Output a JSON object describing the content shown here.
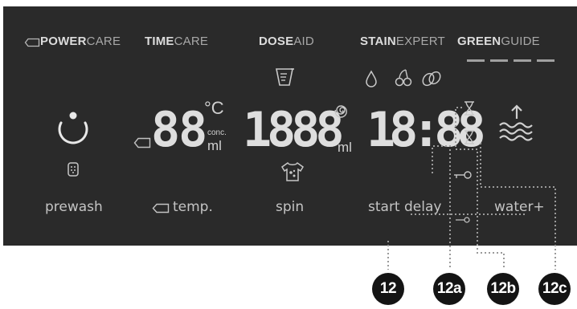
{
  "programs": {
    "powercare": {
      "bold": "POWER",
      "light": "CARE"
    },
    "timecare": {
      "bold": "TIME",
      "light": "CARE"
    },
    "doseaid": {
      "bold": "DOSE",
      "light": "AID"
    },
    "stainexpert": {
      "bold": "STAIN",
      "light": "EXPERT"
    },
    "greenguide": {
      "bold": "GREEN",
      "light": "GUIDE"
    }
  },
  "display": {
    "temp_digits": "88",
    "temp_unit": "°C",
    "conc_label": "conc.",
    "conc_unit": "ml",
    "spin_digits": "1888",
    "spin_unit": "ml",
    "time_digits": "18:88"
  },
  "labels": {
    "prewash": "prewash",
    "temp": "temp.",
    "spin": "spin",
    "start_delay": "start delay",
    "water_plus": "water+"
  },
  "callouts": [
    "12",
    "12a",
    "12b",
    "12c"
  ],
  "colors": {
    "panel": "#2a2a2a",
    "text": "#c4c4c4",
    "callout": "#141414",
    "leader": "#9a9a9a"
  }
}
